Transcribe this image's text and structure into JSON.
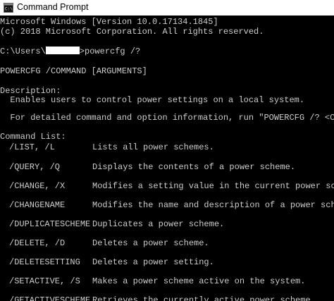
{
  "window": {
    "title": "Command Prompt",
    "icon": "console-icon"
  },
  "console": {
    "header_line1": "Microsoft Windows [Version 10.0.17134.1845]",
    "header_line2": "(c) 2018 Microsoft Corporation. All rights reserved.",
    "prompt_prefix": "C:\\Users\\",
    "prompt_suffix": ">powercfg /?",
    "usage": "POWERCFG /COMMAND [ARGUMENTS]",
    "description_heading": "Description:",
    "description_text": "  Enables users to control power settings on a local system.",
    "detail_text": "  For detailed command and option information, run \"POWERCFG /? <COMMAND>\"",
    "command_list_heading": "Command List:",
    "commands": [
      {
        "name": "/LIST, /L",
        "desc": "Lists all power schemes."
      },
      {
        "name": "/QUERY, /Q",
        "desc": "Displays the contents of a power scheme."
      },
      {
        "name": "/CHANGE, /X",
        "desc": "Modifies a setting value in the current power scheme."
      },
      {
        "name": "/CHANGENAME",
        "desc": "Modifies the name and description of a power scheme."
      },
      {
        "name": "/DUPLICATESCHEME",
        "desc": "Duplicates a power scheme."
      },
      {
        "name": "/DELETE, /D",
        "desc": "Deletes a power scheme."
      },
      {
        "name": "/DELETESETTING",
        "desc": "Deletes a power setting."
      },
      {
        "name": "/SETACTIVE, /S",
        "desc": "Makes a power scheme active on the system."
      },
      {
        "name": "/GETACTIVESCHEME",
        "desc": "Retrieves the currently active power scheme."
      }
    ]
  },
  "colors": {
    "console_background": "#000000",
    "console_text": "#cccccc",
    "titlebar_background": "#ffffff"
  }
}
